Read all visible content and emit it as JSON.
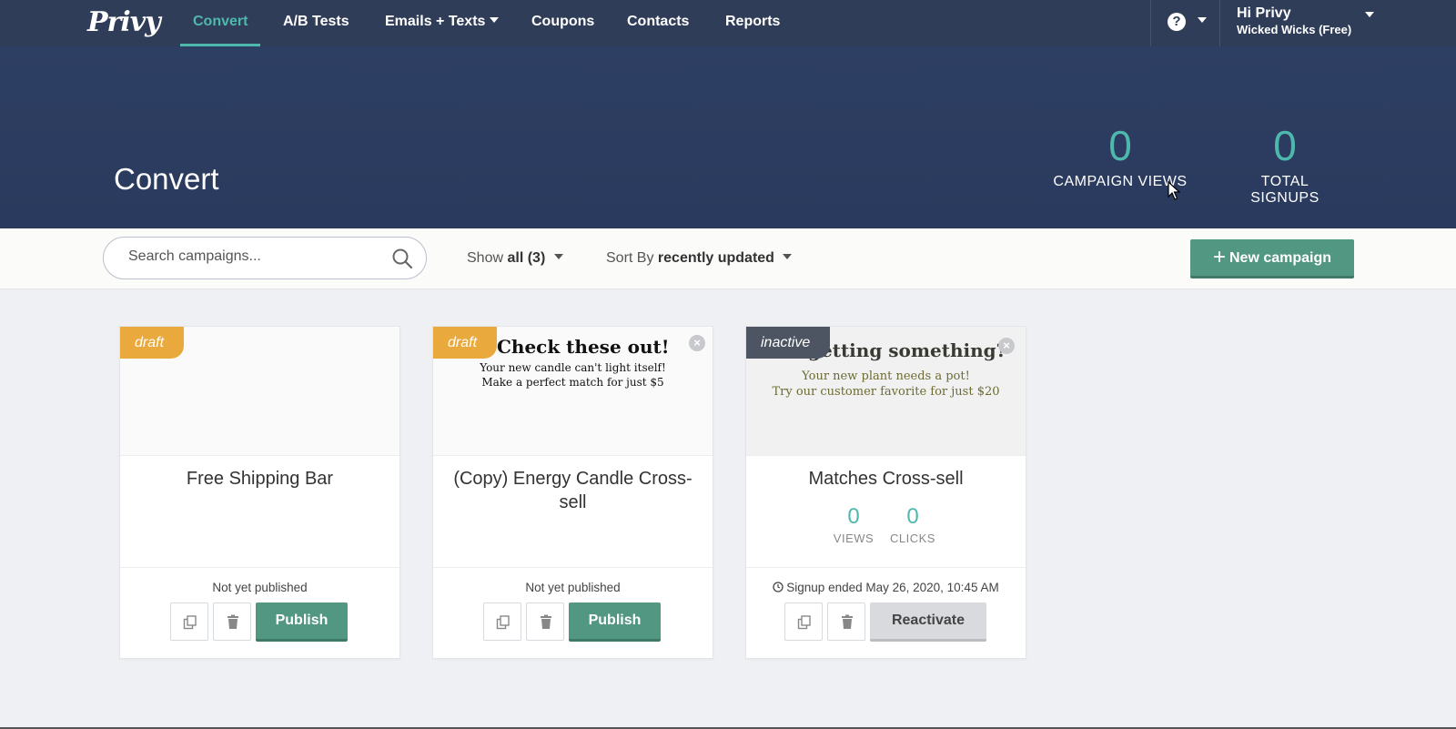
{
  "nav": {
    "logo": "Privy",
    "items": [
      {
        "label": "Convert",
        "active": true
      },
      {
        "label": "A/B Tests"
      },
      {
        "label": "Emails + Texts",
        "dropdown": true
      },
      {
        "label": "Coupons"
      },
      {
        "label": "Contacts"
      },
      {
        "label": "Reports"
      }
    ],
    "help_icon": "question-circle-icon",
    "greeting": "Hi Privy",
    "account": "Wicked Wicks (Free)"
  },
  "hero": {
    "title": "Convert",
    "stats": [
      {
        "value": "0",
        "label": "CAMPAIGN VIEWS"
      },
      {
        "value": "0",
        "label": "TOTAL SIGNUPS"
      }
    ]
  },
  "toolbar": {
    "search_placeholder": "Search campaigns...",
    "show_prefix": "Show",
    "show_value": "all (3)",
    "sort_prefix": "Sort By",
    "sort_value": "recently updated",
    "new_campaign": "New campaign"
  },
  "cards": [
    {
      "badge": "draft",
      "title": "Free Shipping Bar",
      "status": "Not yet published",
      "action": "Publish"
    },
    {
      "badge": "draft",
      "preview_heading": "Check these out!",
      "preview_line1": "Your new candle can't light itself!",
      "preview_line2": "Make a perfect match for just $5",
      "title": "(Copy) Energy Candle Cross-sell",
      "status": "Not yet published",
      "action": "Publish"
    },
    {
      "badge": "inactive",
      "preview_heading": "getting something?",
      "preview_line1": "Your new plant needs a pot!",
      "preview_line2": "Try our customer favorite for just $20",
      "title": "Matches Cross-sell",
      "views": "0",
      "views_label": "VIEWS",
      "clicks": "0",
      "clicks_label": "CLICKS",
      "status": "Signup ended May 26, 2020, 10:45 AM",
      "action": "Reactivate"
    }
  ],
  "colors": {
    "nav_bg": "#2f3d58",
    "hero_bg": "#2d3f62",
    "accent": "#4fb8ad",
    "publish_green": "#529782",
    "draft_orange": "#eaa93c",
    "inactive_gray": "#4d5563"
  }
}
